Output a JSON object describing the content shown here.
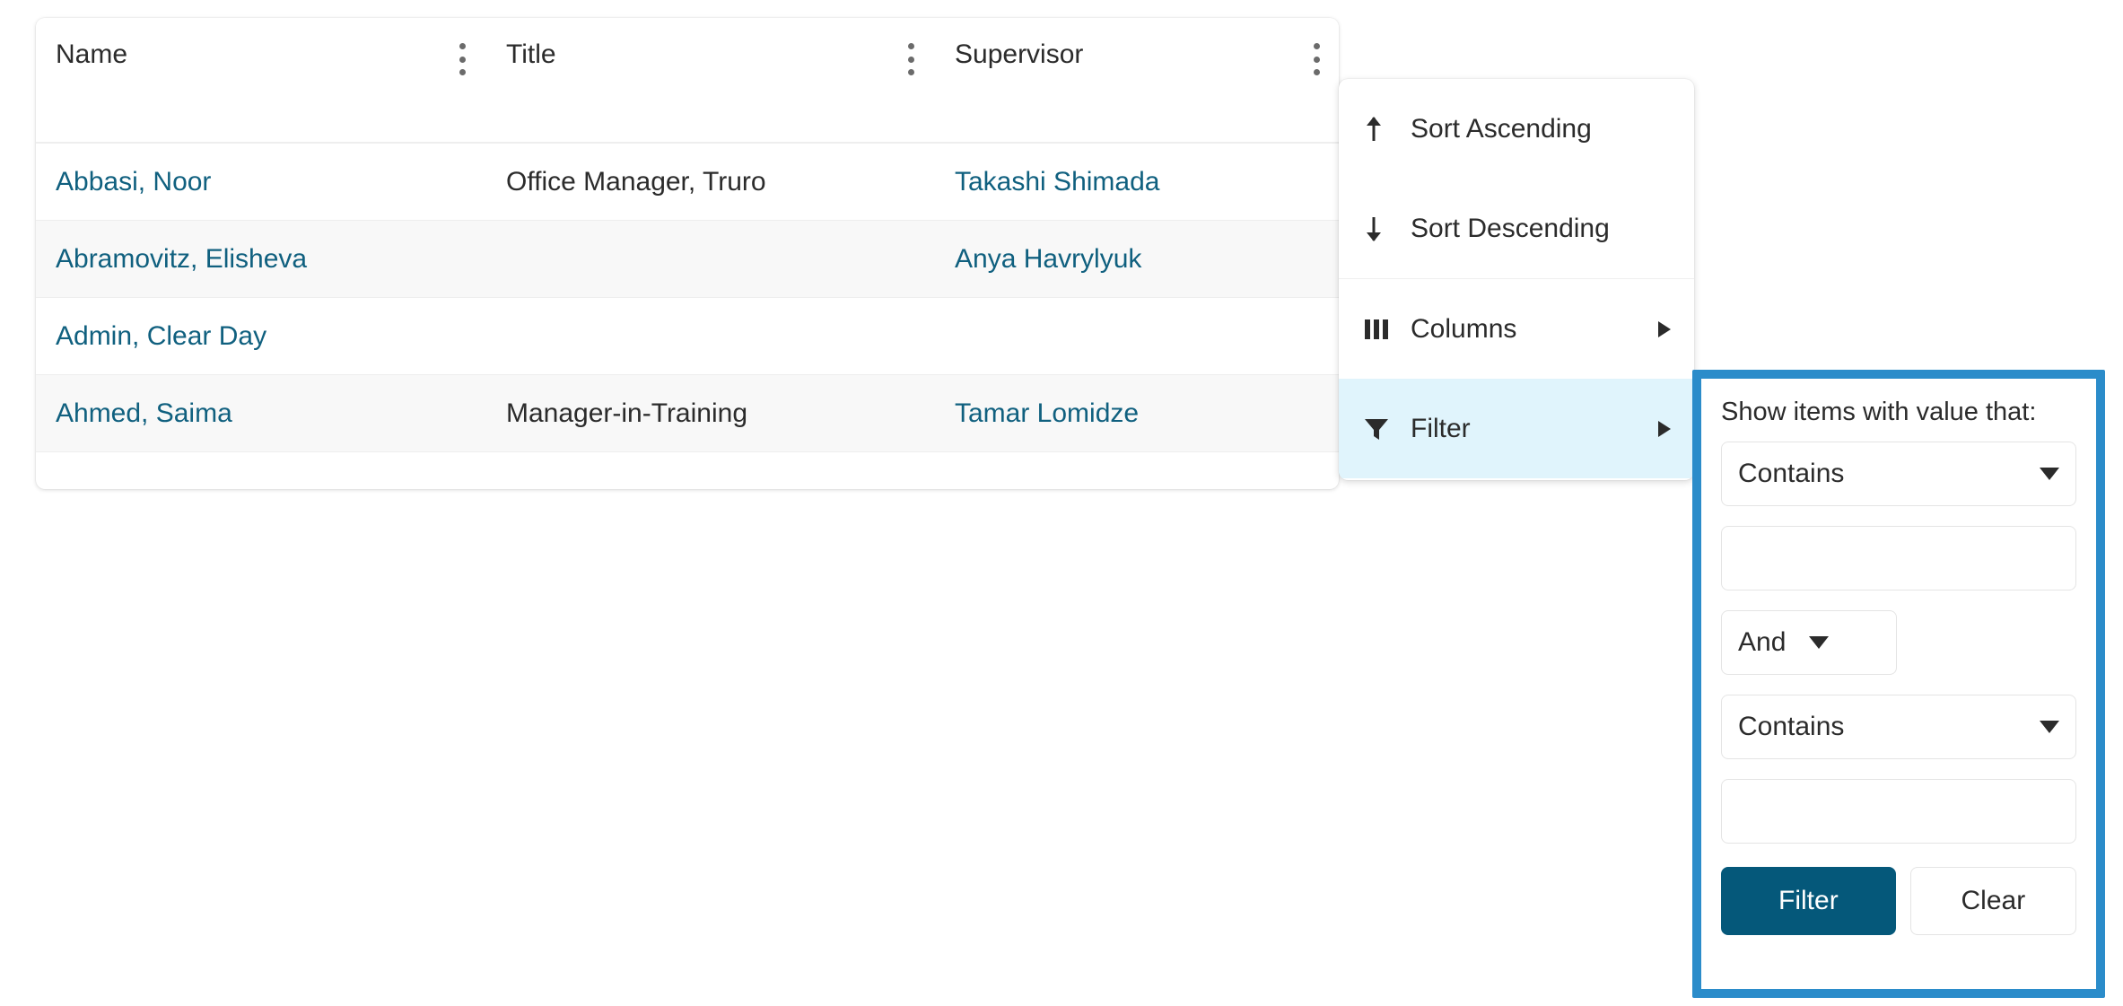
{
  "grid": {
    "columns": [
      {
        "label": "Name",
        "menu_icon": "kebab-menu-icon"
      },
      {
        "label": "Title",
        "menu_icon": "kebab-menu-icon"
      },
      {
        "label": "Supervisor",
        "menu_icon": "kebab-menu-icon"
      }
    ],
    "rows": [
      {
        "name": "Abbasi, Noor",
        "title": "Office Manager, Truro",
        "supervisor": "Takashi Shimada"
      },
      {
        "name": "Abramovitz, Elisheva",
        "title": "",
        "supervisor": "Anya Havrylyuk"
      },
      {
        "name": "Admin, Clear Day",
        "title": "",
        "supervisor": ""
      },
      {
        "name": "Ahmed, Saima",
        "title": "Manager-in-Training",
        "supervisor": "Tamar Lomidze"
      }
    ]
  },
  "context_menu": {
    "items": [
      {
        "label": "Sort Ascending",
        "icon": "arrow-up-icon",
        "has_submenu": false
      },
      {
        "label": "Sort Descending",
        "icon": "arrow-down-icon",
        "has_submenu": false
      },
      {
        "label": "Columns",
        "icon": "columns-icon",
        "has_submenu": true
      },
      {
        "label": "Filter",
        "icon": "funnel-icon",
        "has_submenu": true
      }
    ]
  },
  "filter_panel": {
    "title": "Show items with value that:",
    "operator_1": "Contains",
    "value_1": "",
    "value_1_placeholder": "",
    "logic": "And",
    "operator_2": "Contains",
    "value_2": "",
    "value_2_placeholder": "",
    "filter_button": "Filter",
    "clear_button": "Clear"
  },
  "colors": {
    "accent_border": "#2b8cca",
    "primary_button": "#05587a",
    "link": "#10607f",
    "highlight_row": "#e0f4fc",
    "alt_row": "#f8f8f8"
  }
}
